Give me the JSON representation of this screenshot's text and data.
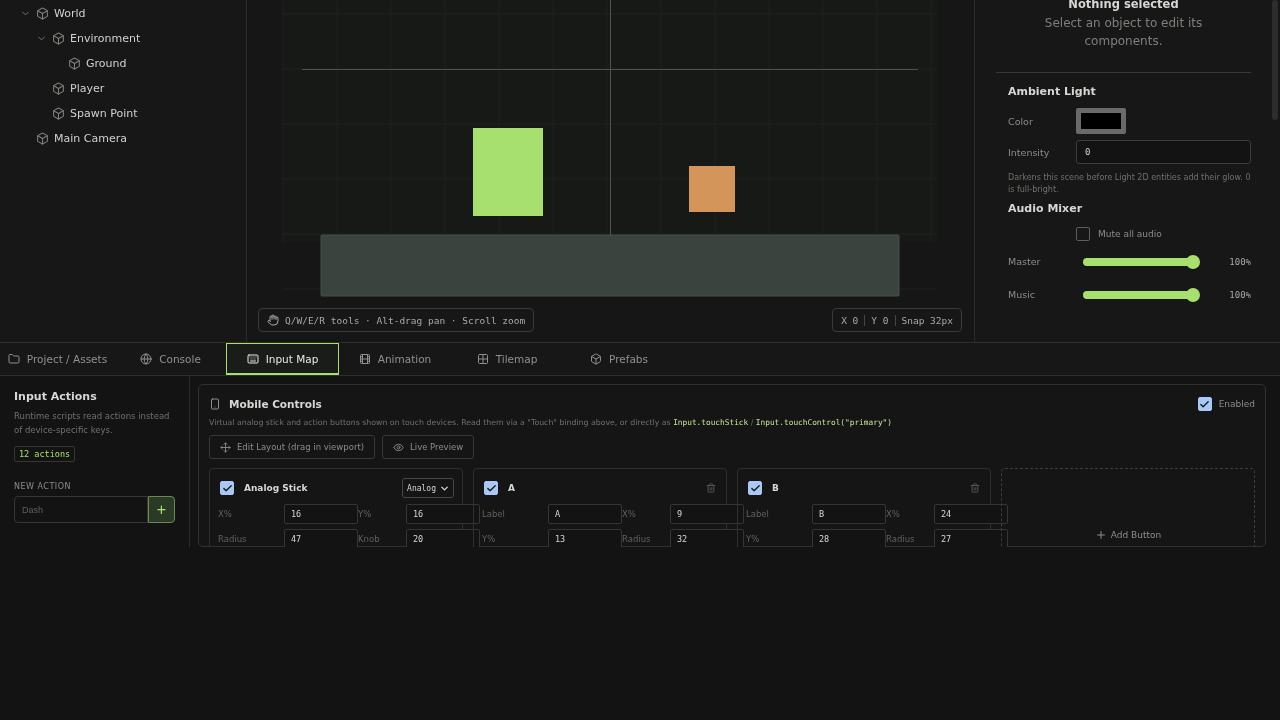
{
  "hierarchy": [
    {
      "label": "World",
      "expanded": true,
      "children": [
        {
          "label": "Environment",
          "expanded": true,
          "children": [
            {
              "label": "Ground"
            }
          ]
        },
        {
          "label": "Player"
        },
        {
          "label": "Spawn Point"
        }
      ]
    },
    {
      "label": "Main Camera"
    }
  ],
  "viewport": {
    "hint": "Q/W/E/R tools · Alt-drag pan · Scroll zoom",
    "coords": [
      "X 0",
      "Y 0",
      "Snap 32px"
    ],
    "entities": [
      {
        "kind": "sprite",
        "color": "#a8e070"
      },
      {
        "kind": "sprite",
        "color": "#d4955a"
      },
      {
        "kind": "ground",
        "color": "#3a433d"
      }
    ]
  },
  "inspector": {
    "title": "Nothing selected",
    "subtitle": "Select an object to edit its components.",
    "ambient": {
      "heading": "Ambient Light",
      "color_label": "Color",
      "color": "#000000",
      "intensity_label": "Intensity",
      "intensity": "0",
      "note": "Darkens this scene before Light 2D entities add their glow. 0 is full-bright."
    },
    "audio": {
      "heading": "Audio Mixer",
      "mute_label": "Mute all audio",
      "muted": false,
      "channels": [
        {
          "name": "Master",
          "level": 1,
          "reading": "100%"
        },
        {
          "name": "Music",
          "level": 1,
          "reading": "100%"
        }
      ]
    }
  },
  "tabs": [
    {
      "label": "Project / Assets",
      "selected": false
    },
    {
      "label": "Console",
      "selected": false
    },
    {
      "label": "Input Map",
      "selected": true
    },
    {
      "label": "Animation",
      "selected": false
    },
    {
      "label": "Tilemap",
      "selected": false
    },
    {
      "label": "Prefabs",
      "selected": false
    }
  ],
  "input_actions": {
    "title": "Input Actions",
    "description": "Runtime scripts read actions instead of device-specific keys.",
    "count": "12 actions",
    "new_label": "NEW ACTION",
    "placeholder": "Dash",
    "add": "+"
  },
  "mobile": {
    "title": "Mobile Controls",
    "enabled_label": "Enabled",
    "enabled": true,
    "description": [
      {
        "kind": "text",
        "text": "Virtual analog stick and action buttons shown on touch devices. Read them via a \"Touch\" binding above, or directly as "
      },
      {
        "kind": "code",
        "text": "Input.touchStick"
      },
      {
        "kind": "text",
        "text": " / "
      },
      {
        "kind": "code",
        "text": "Input.touchControl(\"primary\")"
      }
    ],
    "buttons": [
      {
        "label": "Edit Layout (drag in viewport)"
      },
      {
        "label": "Live Preview"
      }
    ],
    "controls": [
      {
        "kind": "stick",
        "name": "Analog Stick",
        "checked": true,
        "mode": "Analog",
        "fields": [
          {
            "label": "X%",
            "value": "16"
          },
          {
            "label": "Y%",
            "value": "16"
          },
          {
            "label": "Radius",
            "value": "47"
          },
          {
            "label": "Knob",
            "value": "20"
          }
        ]
      },
      {
        "kind": "button",
        "name": "A",
        "checked": true,
        "fields": [
          {
            "label": "Label",
            "value": "A"
          },
          {
            "label": "X%",
            "value": "9"
          },
          {
            "label": "Y%",
            "value": "13"
          },
          {
            "label": "Radius",
            "value": "32"
          }
        ]
      },
      {
        "kind": "button",
        "name": "B",
        "checked": true,
        "fields": [
          {
            "label": "Label",
            "value": "B"
          },
          {
            "label": "X%",
            "value": "24"
          },
          {
            "label": "Y%",
            "value": "28"
          },
          {
            "label": "Radius",
            "value": "27"
          }
        ]
      }
    ],
    "add_label": "Add Button"
  }
}
